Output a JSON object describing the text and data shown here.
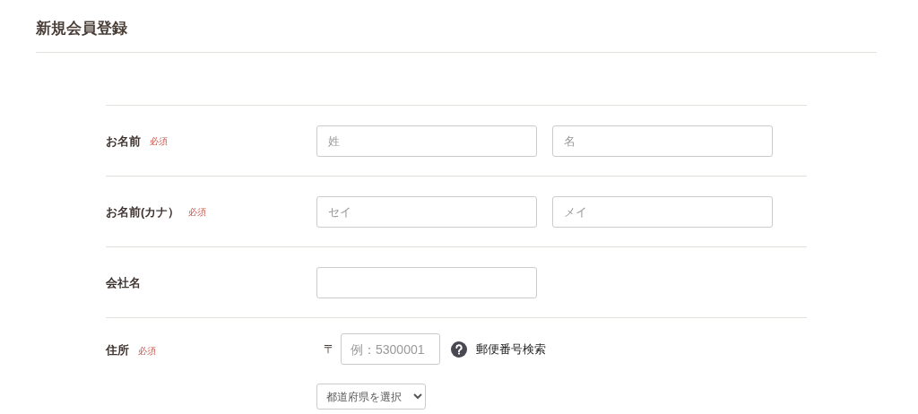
{
  "title": "新規会員登録",
  "rows": [
    {
      "kind": "pair",
      "label": "お名前",
      "badge": "必須",
      "inputs": [
        {
          "placeholder": "姓"
        },
        {
          "placeholder": "名"
        }
      ]
    },
    {
      "kind": "pair",
      "label": "お名前(カナ）",
      "badge": "必須",
      "inputs": [
        {
          "placeholder": "セイ"
        },
        {
          "placeholder": "メイ"
        }
      ]
    },
    {
      "kind": "single",
      "label": "会社名"
    },
    {
      "kind": "address",
      "label": "住所",
      "badge": "必須",
      "postal_mark": "〒",
      "postal": {
        "placeholder": "例：5300001"
      },
      "lookup": "郵便番号検索",
      "prefecture": "都道府県を選択"
    }
  ]
}
